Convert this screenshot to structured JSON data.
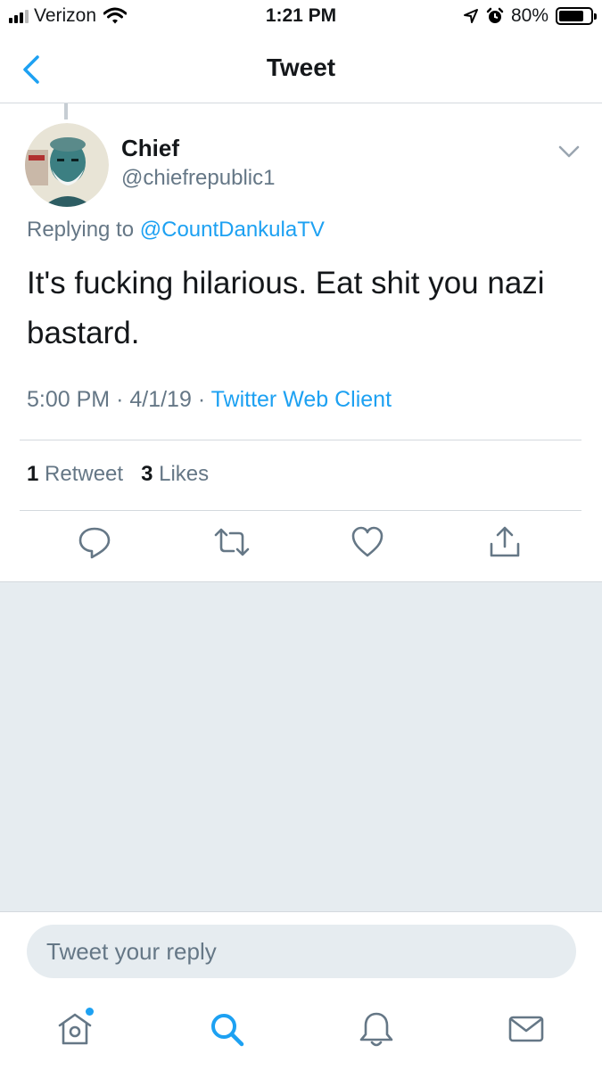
{
  "status_bar": {
    "carrier": "Verizon",
    "time": "1:21 PM",
    "battery": "80%",
    "battery_level": 0.8
  },
  "nav": {
    "title": "Tweet",
    "back_icon": "chevron-left-icon"
  },
  "tweet": {
    "author_name": "Chief",
    "author_handle": "@chiefrepublic1",
    "replying_prefix": "Replying to",
    "replying_to": "@CountDankulaTV",
    "text": "It's fucking hilarious. Eat shit you nazi bastard.",
    "time": "5:00 PM",
    "date": "4/1/19",
    "client": "Twitter Web Client",
    "separator": "·",
    "retweet_count": "1",
    "retweet_label": "Retweet",
    "like_count": "3",
    "like_label": "Likes"
  },
  "actions": [
    "reply-icon",
    "retweet-icon",
    "like-icon",
    "share-icon"
  ],
  "reply_box": {
    "placeholder": "Tweet your reply"
  },
  "tabbar": [
    "home-icon",
    "search-icon",
    "notifications-icon",
    "messages-icon"
  ],
  "colors": {
    "accent": "#1da1f2",
    "secondary_text": "#657786",
    "background_gray": "#e6ecf0"
  }
}
